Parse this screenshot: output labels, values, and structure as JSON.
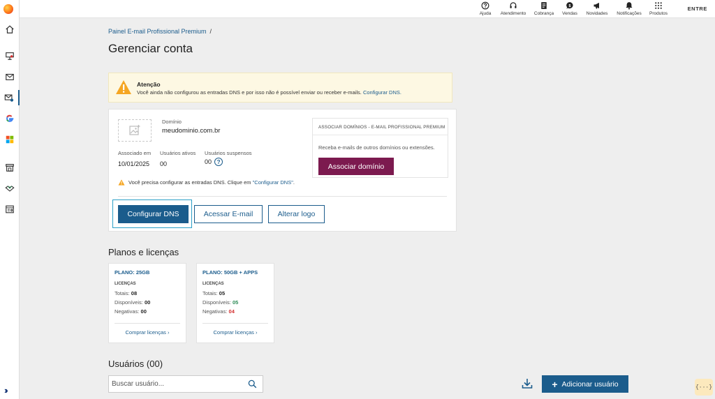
{
  "topbar": {
    "items": [
      {
        "label": "Ajuda",
        "icon": "help-icon"
      },
      {
        "label": "Atendimento",
        "icon": "headset-icon"
      },
      {
        "label": "Cobrança",
        "icon": "billing-icon"
      },
      {
        "label": "Vendas",
        "icon": "sales-icon"
      },
      {
        "label": "Novidades",
        "icon": "megaphone-icon"
      },
      {
        "label": "Notificações",
        "icon": "bell-icon"
      },
      {
        "label": "Produtos",
        "icon": "grid-icon"
      }
    ],
    "login": "ENTRE"
  },
  "breadcrumb": {
    "link": "Painel E-mail Profissional Premium",
    "separator": "/"
  },
  "page_title": "Gerenciar conta",
  "alert": {
    "title": "Atenção",
    "text": "Você ainda não configurou as entradas DNS e por isso não é possível enviar ou receber e-mails.",
    "link": "Configurar DNS."
  },
  "account": {
    "domain_label": "Domínio",
    "domain_value": "meudominio.com.br",
    "associated_label": "Associado em",
    "associated_value": "10/01/2025",
    "active_label": "Usuários ativos",
    "active_value": "00",
    "suspended_label": "Usuários suspensos",
    "suspended_value": "00",
    "help_glyph": "?",
    "warning_text": "Você precisa configurar as entradas DNS. Clique em",
    "warning_link": "\"Configurar DNS\"",
    "warning_end": "."
  },
  "associate": {
    "title": "ASSOCIAR DOMÍNIOS - E-MAIL PROFISSIONAL PREMIUM",
    "text": "Receba e-mails de outros domínios ou extensões.",
    "button": "Associar domínio"
  },
  "actions": {
    "configure_dns": "Configurar DNS",
    "access_email": "Acessar E-mail",
    "change_logo": "Alterar logo"
  },
  "plans_section": {
    "title": "Planos e licenças",
    "plans": [
      {
        "name": "PLANO: 25GB",
        "licenses_label": "LICENÇAS",
        "total_label": "Totais:",
        "total": "08",
        "available_label": "Disponíveis:",
        "available": "00",
        "negative_label": "Negativas:",
        "negative": "00",
        "buy": "Comprar licenças"
      },
      {
        "name": "PLANO: 50GB + APPS",
        "licenses_label": "LICENÇAS",
        "total_label": "Totais:",
        "total": "05",
        "available_label": "Disponíveis:",
        "available": "05",
        "negative_label": "Negativas:",
        "negative": "04",
        "buy": "Comprar licenças"
      }
    ]
  },
  "users_section": {
    "title": "Usuários (00)",
    "search_placeholder": "Buscar usuário...",
    "add_button": "Adicionar usuário",
    "add_glyph": "+"
  },
  "float_badge": "{···}",
  "colors": {
    "primary": "#1b5c8c",
    "accent": "#7c1a4f",
    "warning": "#f5a623",
    "positive": "#2e8b57",
    "negative": "#d32f2f"
  }
}
